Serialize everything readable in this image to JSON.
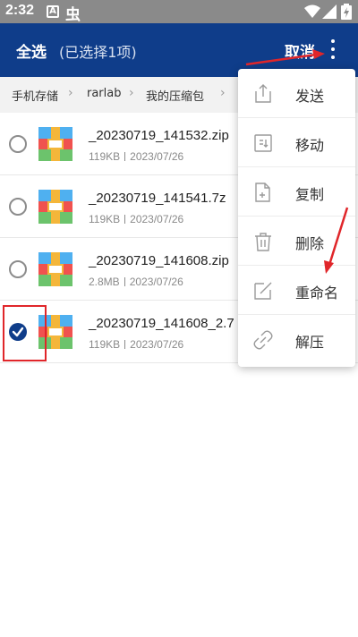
{
  "status_bar": {
    "time": "2:32",
    "notification_letter": "A",
    "notification_glyph": "虫"
  },
  "app_bar": {
    "select_all": "全选",
    "selected_count": "(已选择1项)",
    "cancel": "取消",
    "color": "#0f3d8a"
  },
  "breadcrumb": {
    "items": [
      "手机存储",
      "rarlab",
      "我的压缩包"
    ],
    "separator": "›"
  },
  "files": [
    {
      "name": "_20230719_141532.zip",
      "size": "119KB",
      "date": "2023/07/26",
      "checked": false
    },
    {
      "name": "_20230719_141541.7z",
      "size": "119KB",
      "date": "2023/07/26",
      "checked": false
    },
    {
      "name": "_20230719_141608.zip",
      "size": "2.8MB",
      "date": "2023/07/26",
      "checked": false
    },
    {
      "name": "_20230719_141608_2.7",
      "size": "119KB",
      "date": "2023/07/26",
      "checked": true
    }
  ],
  "menu": {
    "items": [
      {
        "label": "发送",
        "icon": "share-icon"
      },
      {
        "label": "移动",
        "icon": "move-icon"
      },
      {
        "label": "复制",
        "icon": "copy-icon"
      },
      {
        "label": "删除",
        "icon": "delete-icon"
      },
      {
        "label": "重命名",
        "icon": "rename-icon"
      },
      {
        "label": "解压",
        "icon": "extract-icon"
      }
    ]
  },
  "annotation_color": "#e0262a"
}
